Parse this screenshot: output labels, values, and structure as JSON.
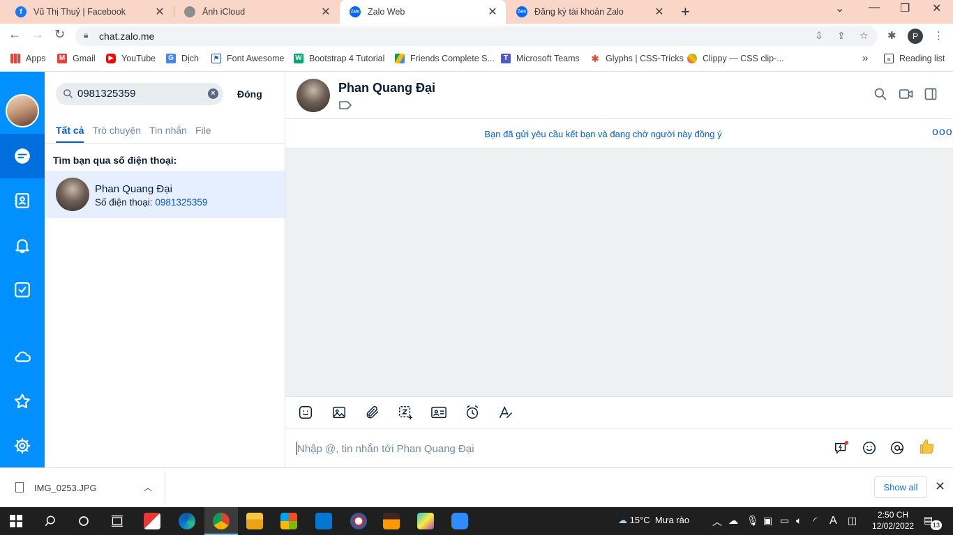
{
  "browser": {
    "tabs": [
      {
        "title": "Vũ Thị Thuỷ | Facebook",
        "icon": "facebook-icon"
      },
      {
        "title": "Ảnh iCloud",
        "icon": "apple-icon"
      },
      {
        "title": "Zalo Web",
        "icon": "zalo-icon"
      },
      {
        "title": "Đăng ký tài khoản Zalo",
        "icon": "zalo-icon"
      }
    ],
    "active_tab": 2,
    "url": "chat.zalo.me",
    "profile_initial": "P",
    "bookmarks": [
      {
        "label": "Apps"
      },
      {
        "label": "Gmail"
      },
      {
        "label": "YouTube"
      },
      {
        "label": "Dịch"
      },
      {
        "label": "Font Awesome"
      },
      {
        "label": "Bootstrap 4 Tutorial"
      },
      {
        "label": "Friends Complete S..."
      },
      {
        "label": "Microsoft Teams"
      },
      {
        "label": "Glyphs | CSS-Tricks"
      },
      {
        "label": "Clippy — CSS clip-..."
      }
    ],
    "reading_list": "Reading list",
    "overflow": "»"
  },
  "search_panel": {
    "query": "0981325359",
    "close_label": "Đóng",
    "tabs": [
      "Tất cả",
      "Trò chuyện",
      "Tin nhắn",
      "File"
    ],
    "active_tab": 0,
    "section_title": "Tìm bạn qua số điện thoại:",
    "result": {
      "name": "Phan Quang Đại",
      "phone_label": "Số điện thoại:",
      "phone": "0981325359"
    }
  },
  "chat": {
    "name": "Phan Quang Đại",
    "notice": "Bạn đã gửi yêu cầu kết bạn và đang chờ người này đồng ý",
    "more": "ooo",
    "input_placeholder": "Nhập @, tin nhắn tới Phan Quang Đại"
  },
  "download": {
    "file": "IMG_0253.JPG",
    "show_all": "Show all"
  },
  "taskbar": {
    "temperature": "15°C",
    "weather": "Mưa rào",
    "time": "2:50 CH",
    "date": "12/02/2022",
    "notifications": "13",
    "keyboard": "A"
  },
  "colors": {
    "zalo_blue": "#0091ff",
    "zalo_active": "#006edc",
    "link_blue": "#005ae0",
    "tabstrip": "#f9d6c7"
  }
}
